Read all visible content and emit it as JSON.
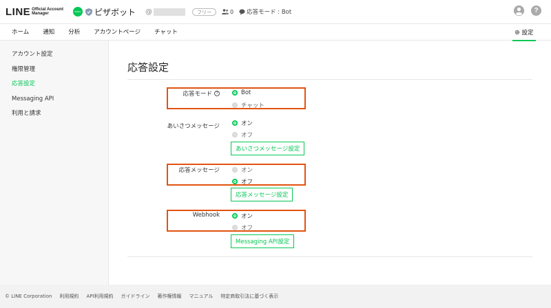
{
  "header": {
    "logo_main": "LINE",
    "logo_sub_1": "Official Account",
    "logo_sub_2": "Manager",
    "account_avatar_text": "PIZZA",
    "account_name": "ピザボット",
    "account_id_prefix": "@",
    "plan_badge": "フリー",
    "friends_count": "0",
    "mode_text": "応答モード : Bot",
    "help_glyph": "?",
    "colors": {
      "brand": "#06c755",
      "highlight": "#e2520f"
    }
  },
  "nav": {
    "items": [
      "ホーム",
      "通知",
      "分析",
      "アカウントページ",
      "チャット"
    ],
    "settings_label": "設定"
  },
  "sidebar": {
    "items": [
      "アカウント設定",
      "権限管理",
      "応答設定",
      "Messaging API",
      "利用と請求"
    ],
    "active": "応答設定"
  },
  "main": {
    "title": "応答設定",
    "response_mode": {
      "label": "応答モード",
      "options": [
        "Bot",
        "チャット"
      ],
      "selected": "Bot"
    },
    "greeting": {
      "label": "あいさつメッセージ",
      "options": [
        "オン",
        "オフ"
      ],
      "selected": "オン",
      "button": "あいさつメッセージ設定"
    },
    "auto_reply": {
      "label": "応答メッセージ",
      "options": [
        "オン",
        "オフ"
      ],
      "selected": "オフ",
      "button": "応答メッセージ設定"
    },
    "webhook": {
      "label": "Webhook",
      "options": [
        "オン",
        "オフ"
      ],
      "selected": "オン",
      "button": "Messaging API設定"
    }
  },
  "footer": {
    "links": [
      "© LINE Corporation",
      "利用規約",
      "API利用規約",
      "ガイドライン",
      "著作権情報",
      "マニュアル",
      "特定商取引法に基づく表示"
    ]
  }
}
